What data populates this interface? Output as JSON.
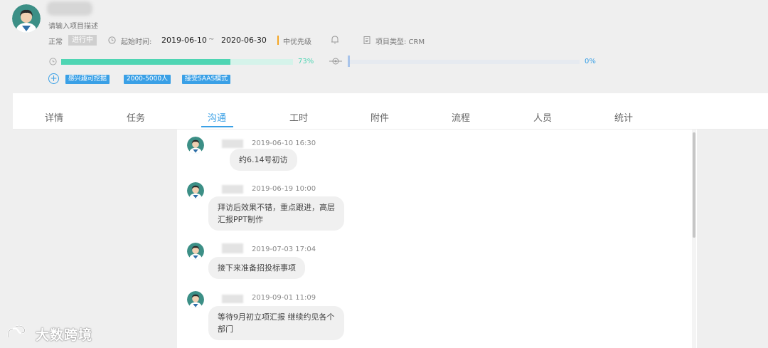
{
  "project": {
    "description_placeholder": "请输入项目描述",
    "status_normal": "正常",
    "status_badge": "进行中",
    "start_label": "起始时间:",
    "start_date": "2019-06-10",
    "date_sep": "~",
    "end_date": "2020-06-30",
    "priority": "中优先级",
    "type_label": "项目类型: CRM",
    "progress_text": "73%",
    "progress_value": 0.73,
    "secondary_text": "0%",
    "secondary_value": 0.0,
    "tags": [
      "感兴趣可挖掘",
      "2000-5000人",
      "接受SAAS模式"
    ]
  },
  "tabs": [
    "详情",
    "任务",
    "沟通",
    "工时",
    "附件",
    "流程",
    "人员",
    "统计"
  ],
  "active_tab": "沟通",
  "messages": [
    {
      "time": "2019-06-10 16:30",
      "lines": [
        "约6.14号初访"
      ]
    },
    {
      "time": "2019-06-19 10:00",
      "lines": [
        "拜访后效果不错，重点跟进，高层",
        "汇报PPT制作"
      ]
    },
    {
      "time": "2019-07-03 17:04",
      "lines": [
        "接下来准备招投标事项"
      ]
    },
    {
      "time": "2019-09-01 11:09",
      "lines": [
        "等待9月初立项汇报 继续约见各个",
        "部门"
      ]
    }
  ],
  "watermark": "大数跨境",
  "colors": {
    "accent": "#3aa0e6",
    "progress": "#4fd5b3",
    "priority": "#f5a623"
  },
  "icons": [
    "user-avatar",
    "clock-icon",
    "bell-icon",
    "document-icon",
    "target-icon",
    "plus-circle-icon"
  ]
}
